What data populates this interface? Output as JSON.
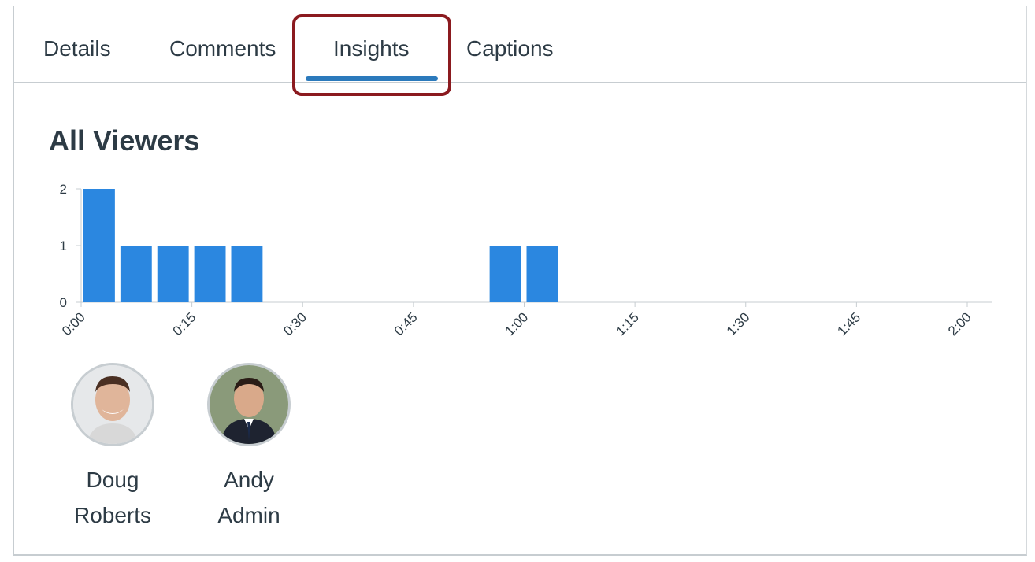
{
  "tabs": [
    {
      "label": "Details"
    },
    {
      "label": "Comments"
    },
    {
      "label": "Insights",
      "selected": true
    },
    {
      "label": "Captions"
    }
  ],
  "section_title": "All Viewers",
  "chart_data": {
    "type": "bar",
    "x_unit": "mm:ss",
    "x": [
      "0:00",
      "0:05",
      "0:10",
      "0:15",
      "0:20",
      "0:55",
      "1:00"
    ],
    "values": [
      2,
      1,
      1,
      1,
      1,
      1,
      1
    ],
    "xlim": [
      "0:00",
      "2:00"
    ],
    "xticks": [
      "0:00",
      "0:15",
      "0:30",
      "0:45",
      "1:00",
      "1:15",
      "1:30",
      "1:45",
      "2:00"
    ],
    "ylim": [
      0,
      2
    ],
    "yticks": [
      "0",
      "1",
      "2"
    ],
    "bar_color": "#2b87e0",
    "grid": false
  },
  "viewers": [
    {
      "name": "Doug Roberts",
      "avatar_icon": "user-photo-icon"
    },
    {
      "name": "Andy Admin",
      "avatar_icon": "user-photo-icon"
    }
  ],
  "colors": {
    "accent": "#2b7abc",
    "highlight_outline": "#8b1a1f",
    "text": "#2d3b45"
  }
}
